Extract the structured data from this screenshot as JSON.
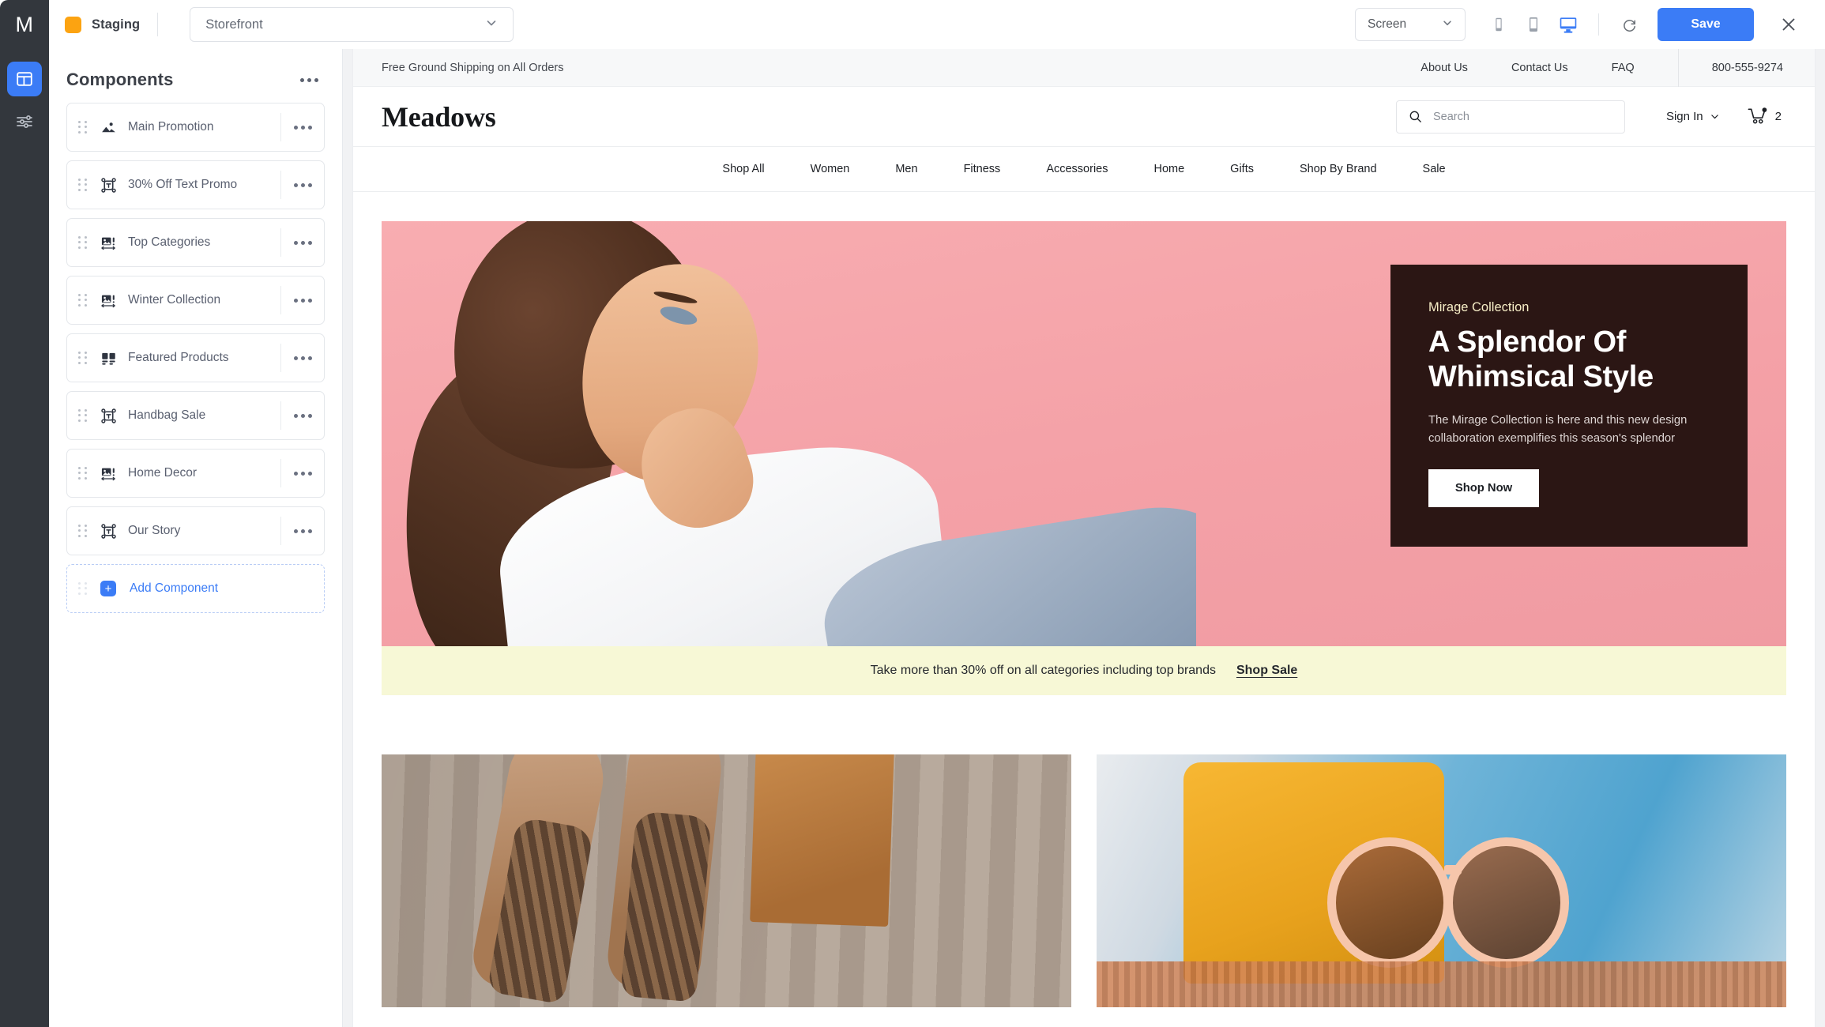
{
  "topbar": {
    "logo_letter": "M",
    "env_label": "Staging",
    "env_color": "#fca311",
    "store_select": {
      "value": "Storefront"
    },
    "screen_select": {
      "value": "Screen"
    },
    "devices": [
      {
        "name": "mobile",
        "active": false
      },
      {
        "name": "tablet",
        "active": false
      },
      {
        "name": "desktop",
        "active": true
      }
    ],
    "refresh_title": "Refresh",
    "save_label": "Save",
    "save_color": "#3b7cf6",
    "close_title": "Close"
  },
  "rail": {
    "items": [
      {
        "icon": "layout-icon",
        "active": true
      },
      {
        "icon": "sliders-icon",
        "active": false
      }
    ]
  },
  "panel": {
    "title": "Components",
    "menu_label": "•••",
    "components": [
      {
        "label": "Main Promotion",
        "icon": "image-icon"
      },
      {
        "label": "30% Off Text Promo",
        "icon": "text-block-icon"
      },
      {
        "label": "Top Categories",
        "icon": "carousel-icon"
      },
      {
        "label": "Winter Collection",
        "icon": "carousel-icon"
      },
      {
        "label": "Featured Products",
        "icon": "grid-icon"
      },
      {
        "label": "Handbag Sale",
        "icon": "text-block-icon"
      },
      {
        "label": "Home Decor",
        "icon": "carousel-icon"
      },
      {
        "label": "Our Story",
        "icon": "text-block-icon"
      }
    ],
    "add_component_label": "Add Component"
  },
  "preview": {
    "utility_bar": {
      "message": "Free Ground Shipping on All Orders",
      "links": [
        "About Us",
        "Contact Us",
        "FAQ"
      ],
      "phone": "800-555-9274"
    },
    "masthead": {
      "logo": "Meadows",
      "search_placeholder": "Search",
      "search_value": "",
      "sign_in_label": "Sign In",
      "cart_count": "2"
    },
    "nav": [
      "Shop All",
      "Women",
      "Men",
      "Fitness",
      "Accessories",
      "Home",
      "Gifts",
      "Shop By Brand",
      "Sale"
    ],
    "hero": {
      "eyebrow": "Mirage Collection",
      "title": "A Splendor Of Whimsical Style",
      "body": "The Mirage Collection is here and this new design collaboration exemplifies this season's splendor",
      "cta": "Shop Now",
      "card_bg": "#2b1614",
      "eyebrow_color": "#f7eec7",
      "image_bg": "#f4a1a7"
    },
    "promo": {
      "text": "Take more than 30% off on all categories including top brands",
      "link": "Shop Sale",
      "bg": "#f7f8d6"
    },
    "tiles": [
      {
        "name": "boots-and-handbag-tile"
      },
      {
        "name": "sunglasses-tile"
      }
    ]
  }
}
